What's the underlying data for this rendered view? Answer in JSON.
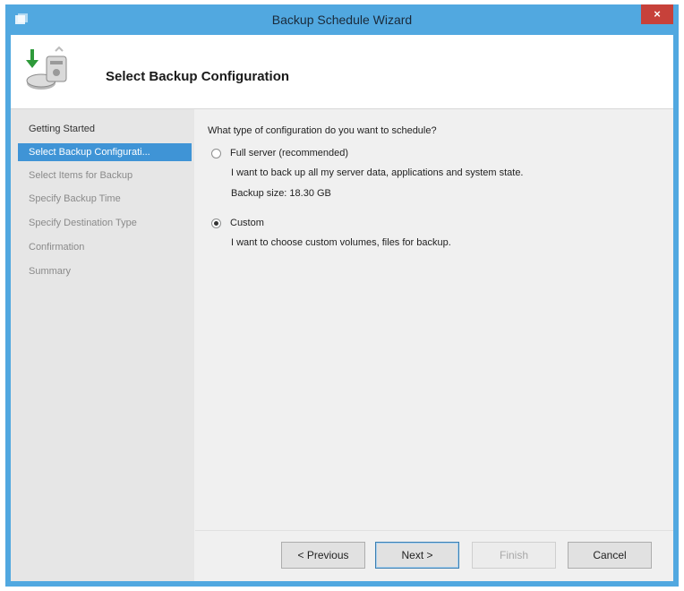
{
  "window": {
    "title": "Backup Schedule Wizard",
    "close_glyph": "×"
  },
  "header": {
    "title": "Select Backup Configuration",
    "icon": "backup-wizard-icon"
  },
  "nav": {
    "items": [
      {
        "label": "Getting Started",
        "state": "done"
      },
      {
        "label": "Select Backup Configurati...",
        "state": "active"
      },
      {
        "label": "Select Items for Backup",
        "state": "pending"
      },
      {
        "label": "Specify Backup Time",
        "state": "pending"
      },
      {
        "label": "Specify Destination Type",
        "state": "pending"
      },
      {
        "label": "Confirmation",
        "state": "pending"
      },
      {
        "label": "Summary",
        "state": "pending"
      }
    ]
  },
  "content": {
    "question": "What type of configuration do you want to schedule?",
    "options": [
      {
        "label": "Full server (recommended)",
        "checked": false,
        "description": "I want to back up all my server data, applications and system state.",
        "size": "Backup size: 18.30 GB"
      },
      {
        "label": "Custom",
        "checked": true,
        "description": "I want to choose custom volumes, files for backup."
      }
    ]
  },
  "buttons": {
    "previous": "< Previous",
    "next": "Next >",
    "finish": "Finish",
    "cancel": "Cancel"
  },
  "colors": {
    "titlebar": "#51a8e0",
    "nav_active": "#3f94d6",
    "close": "#c7413a"
  }
}
